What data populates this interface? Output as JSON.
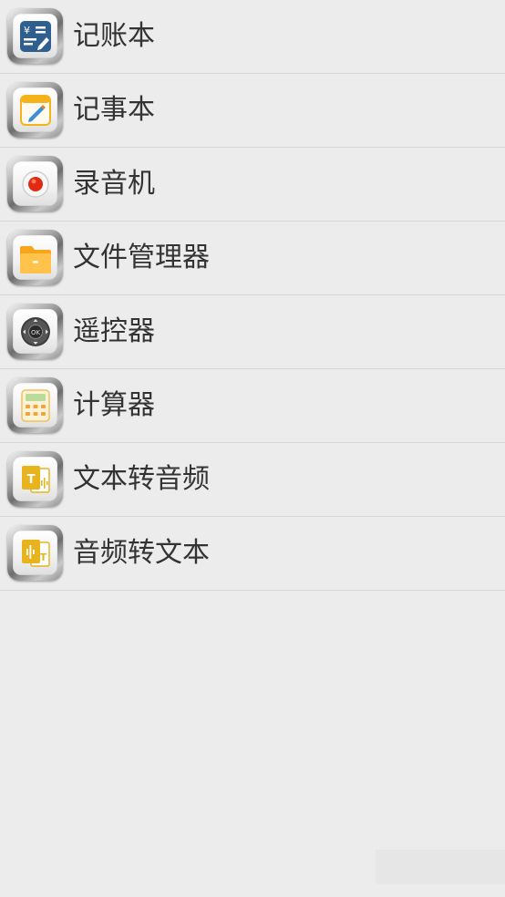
{
  "apps": [
    {
      "label": "记账本",
      "icon": "ledger-icon"
    },
    {
      "label": "记事本",
      "icon": "notepad-icon"
    },
    {
      "label": "录音机",
      "icon": "recorder-icon"
    },
    {
      "label": "文件管理器",
      "icon": "file-manager-icon"
    },
    {
      "label": "遥控器",
      "icon": "remote-control-icon"
    },
    {
      "label": "计算器",
      "icon": "calculator-icon"
    },
    {
      "label": "文本转音频",
      "icon": "text-to-audio-icon"
    },
    {
      "label": "音频转文本",
      "icon": "audio-to-text-icon"
    }
  ],
  "colors": {
    "background": "#ececec",
    "divider": "#d6d6d6",
    "label_text": "#333333",
    "ledger_blue": "#2f5f8e",
    "note_yellow": "#f6b21a",
    "record_red": "#e02a12",
    "folder_orange": "#f7a51c",
    "accent_gold": "#e8b41e"
  }
}
